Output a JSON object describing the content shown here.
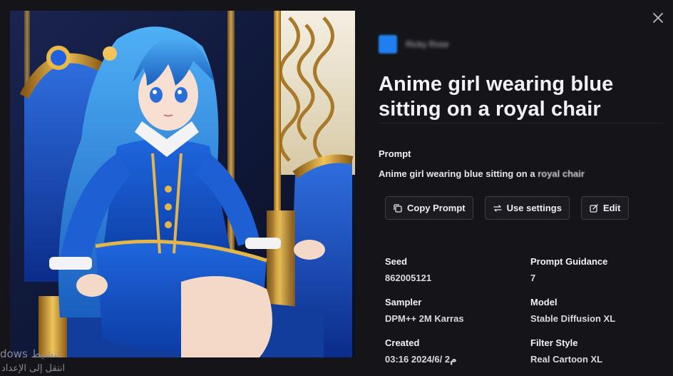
{
  "image": {
    "alt": "Anime girl wearing blue sitting on a royal chair"
  },
  "watermark": {
    "line1": "dows تنشيط",
    "line2": "انتقل إلى الإعداد"
  },
  "author": {
    "name": "Ricky Rose"
  },
  "title": "Anime girl wearing blue sitting on a royal chair",
  "prompt": {
    "label": "Prompt",
    "text_main": "Anime girl wearing blue sitting on a ",
    "text_fade": "royal chair"
  },
  "actions": {
    "copy_prompt": "Copy Prompt",
    "use_settings": "Use settings",
    "edit": "Edit"
  },
  "meta": {
    "seed_label": "Seed",
    "seed_value": "862005121",
    "guidance_label": "Prompt Guidance",
    "guidance_value": "7",
    "sampler_label": "Sampler",
    "sampler_value": "DPM++ 2M Karras",
    "model_label": "Model",
    "model_value": "Stable Diffusion XL",
    "created_label": "Created",
    "created_value": "03:16 2024/6/ م2",
    "filter_label": "Filter Style",
    "filter_value": "Real Cartoon XL"
  },
  "colors": {
    "background": "#151519",
    "accent": "#1f7ff0",
    "button_border": "#3d3d46"
  },
  "icons": {
    "close": "close-icon",
    "copy": "copy-icon",
    "settings": "repeat-icon",
    "edit": "edit-icon"
  }
}
